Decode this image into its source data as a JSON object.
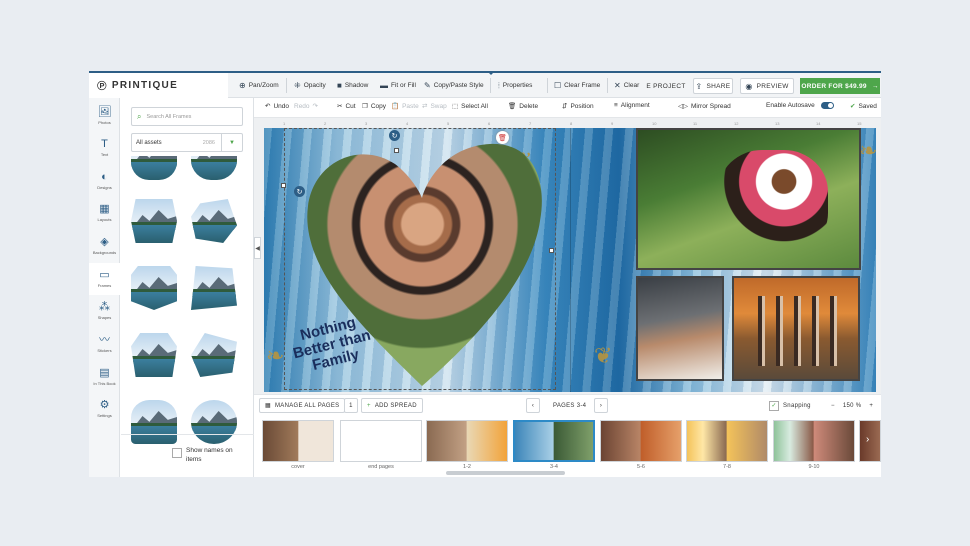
{
  "topbar": {
    "logo": "PRINTIQUE",
    "tools": [
      {
        "icon": "pan-zoom-icon",
        "label": "Pan/Zoom"
      },
      {
        "icon": "opacity-icon",
        "label": "Opacity"
      },
      {
        "icon": "shadow-icon",
        "label": "Shadow"
      },
      {
        "icon": "fit-fill-icon",
        "label": "Fit or Fill"
      },
      {
        "icon": "copy-paste-style-icon",
        "label": "Copy/Paste Style"
      },
      {
        "icon": "properties-icon",
        "label": "Properties"
      },
      {
        "icon": "clear-frame-icon",
        "label": "Clear Frame"
      },
      {
        "icon": "clear-icon",
        "label": "Clear"
      }
    ],
    "project_label": "E PROJECT",
    "share_label": "SHARE",
    "preview_label": "PREVIEW",
    "order_label": "ORDER FOR $49.99"
  },
  "toolbar2": {
    "undo": "Undo",
    "redo": "Redo",
    "cut": "Cut",
    "copy": "Copy",
    "paste": "Paste",
    "swap": "Swap",
    "select_all": "Select All",
    "delete": "Delete",
    "position": "Position",
    "alignment": "Alignment",
    "mirror_spread": "Mirror Spread",
    "autosave": "Enable Autosave",
    "saved": "Saved"
  },
  "leftnav": [
    {
      "icon": "photos-icon",
      "label": "Photos"
    },
    {
      "icon": "text-icon",
      "label": "Text"
    },
    {
      "icon": "designs-icon",
      "label": "Designs"
    },
    {
      "icon": "layouts-icon",
      "label": "Layouts"
    },
    {
      "icon": "backgrounds-icon",
      "label": "Backgrounds"
    },
    {
      "icon": "frames-icon",
      "label": "Frames"
    },
    {
      "icon": "shapes-icon",
      "label": "Shapes"
    },
    {
      "icon": "stickers-icon",
      "label": "Stickers"
    },
    {
      "icon": "in-this-book-icon",
      "label": "In This Book"
    },
    {
      "icon": "settings-icon",
      "label": "Settings"
    }
  ],
  "panel": {
    "search_placeholder": "Search All Frames",
    "assets_label": "All assets",
    "assets_count": "2086",
    "show_names": "Show names on items"
  },
  "ruler": [
    "1",
    "2",
    "3",
    "4",
    "5",
    "6",
    "7",
    "8",
    "9",
    "10",
    "11",
    "12",
    "13",
    "14",
    "15"
  ],
  "canvas": {
    "text_art": "Nothing Better than Family"
  },
  "bottombar": {
    "manage_pages": "MANAGE ALL PAGES",
    "page_number": "1",
    "add_spread": "ADD SPREAD",
    "pages_label": "PAGES 3-4",
    "snapping": "Snapping",
    "zoom": "150 %"
  },
  "strip": [
    {
      "label": "cover"
    },
    {
      "label": "end pages"
    },
    {
      "label": "1-2"
    },
    {
      "label": "3-4"
    },
    {
      "label": "5-6"
    },
    {
      "label": "7-8"
    },
    {
      "label": "9-10"
    }
  ]
}
